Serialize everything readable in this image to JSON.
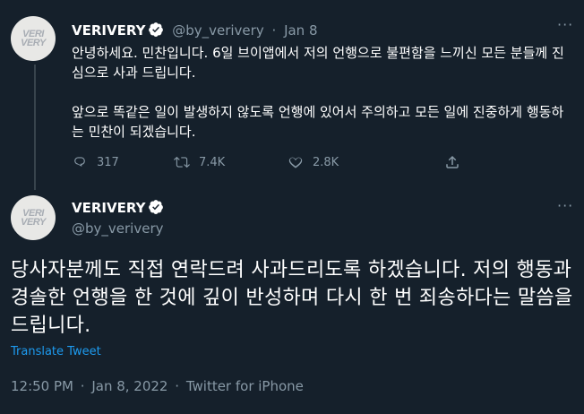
{
  "tweet1": {
    "display_name": "VERIVERY",
    "handle": "@by_verivery",
    "separator": "·",
    "date": "Jan 8",
    "avatar_text_1": "VERI",
    "avatar_text_2": "VERY",
    "paragraphs": [
      "안녕하세요. 민찬입니다. 6일 브이앱에서 저의 언행으로 불편함을 느끼신 모든 분들께 진심으로 사과 드립니다.",
      "앞으로 똑같은 일이 발생하지 않도록 언행에 있어서 주의하고 모든 일에 진중하게 행동하는 민찬이 되겠습니다."
    ],
    "replies": "317",
    "retweets": "7.4K",
    "likes": "2.8K"
  },
  "tweet2": {
    "display_name": "VERIVERY",
    "handle": "@by_verivery",
    "avatar_text_1": "VERI",
    "avatar_text_2": "VERY",
    "text": "당사자분께도 직접 연락드려 사과드리도록 하겠습니다. 저의 행동과 경솔한 언행을 한 것에 깊이 반성하며 다시 한 번 죄송하다는 말씀을 드립니다.",
    "translate_label": "Translate Tweet",
    "time": "12:50 PM",
    "separator_1": "·",
    "date": "Jan 8, 2022",
    "separator_2": "·",
    "source": "Twitter for iPhone"
  },
  "colors": {
    "background": "#15202b",
    "text": "#ffffff",
    "muted": "#8899a6",
    "link": "#1d9bf0",
    "verified": "#ffffff"
  },
  "icons": [
    "verified-badge-icon",
    "more-icon",
    "reply-icon",
    "retweet-icon",
    "like-icon",
    "share-icon"
  ]
}
